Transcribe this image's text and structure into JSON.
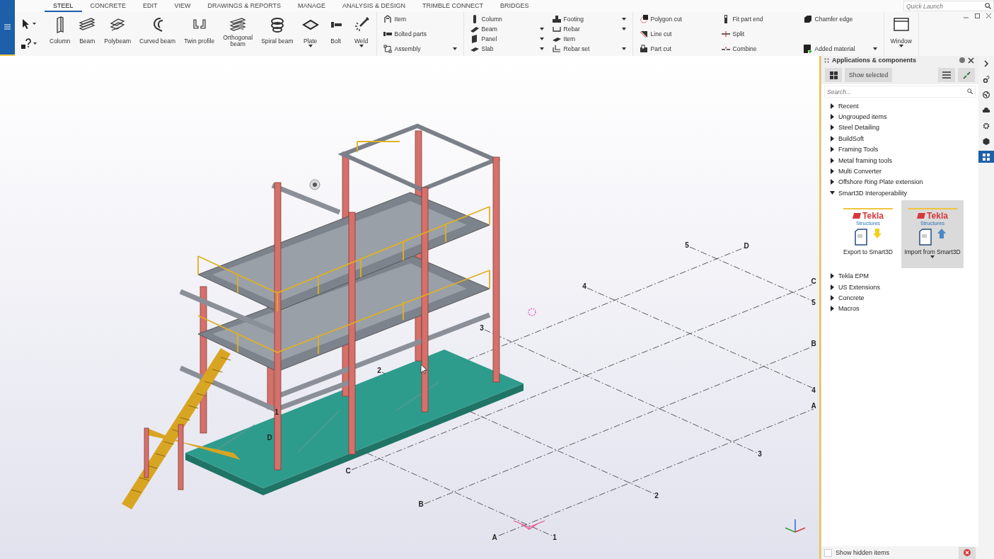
{
  "tabs": [
    {
      "label": "STEEL",
      "selected": true
    },
    {
      "label": "CONCRETE",
      "selected": false
    },
    {
      "label": "EDIT",
      "selected": false
    },
    {
      "label": "VIEW",
      "selected": false
    },
    {
      "label": "DRAWINGS & REPORTS",
      "selected": false
    },
    {
      "label": "MANAGE",
      "selected": false
    },
    {
      "label": "ANALYSIS & DESIGN",
      "selected": false
    },
    {
      "label": "TRIMBLE CONNECT",
      "selected": false
    },
    {
      "label": "BRIDGES",
      "selected": false
    }
  ],
  "quick_launch": {
    "placeholder": "Quick Launch"
  },
  "ribbon": {
    "groups": [
      {
        "kind": "large",
        "tools": [
          {
            "label": "Column",
            "dropdown": false
          },
          {
            "label": "Beam",
            "dropdown": false
          },
          {
            "label": "Polybeam",
            "dropdown": false
          },
          {
            "label": "Curved beam",
            "dropdown": false
          },
          {
            "label": "Twin profile",
            "dropdown": false
          },
          {
            "label": "Orthogonal\nbeam",
            "dropdown": false
          },
          {
            "label": "Spiral beam",
            "dropdown": false
          },
          {
            "label": "Plate",
            "dropdown": true
          },
          {
            "label": "Bolt",
            "dropdown": false
          },
          {
            "label": "Weld",
            "dropdown": true
          }
        ]
      },
      {
        "kind": "small",
        "columns": [
          [
            {
              "label": "Item",
              "dropdown": false
            },
            {
              "label": "Bolted parts",
              "dropdown": false
            },
            {
              "label": "Assembly",
              "dropdown": true
            }
          ]
        ]
      },
      {
        "kind": "small",
        "columns": [
          [
            {
              "label": "Column",
              "dropdown": false
            },
            {
              "label": "Beam",
              "dropdown": true
            },
            {
              "label": "Panel",
              "dropdown": true
            },
            {
              "label": "Slab",
              "dropdown": true
            }
          ],
          [
            {
              "label": "Footing",
              "dropdown": true
            },
            {
              "label": "Rebar",
              "dropdown": true
            },
            {
              "label": "Item",
              "dropdown": false
            },
            {
              "label": "Rebar set",
              "dropdown": true
            }
          ]
        ]
      },
      {
        "kind": "small",
        "columns": [
          [
            {
              "label": "Polygon cut",
              "dropdown": false
            },
            {
              "label": "Line cut",
              "dropdown": false
            },
            {
              "label": "Part cut",
              "dropdown": false
            }
          ],
          [
            {
              "label": "Fit part end",
              "dropdown": false
            },
            {
              "label": "Split",
              "dropdown": false
            },
            {
              "label": "Combine",
              "dropdown": false
            }
          ],
          [
            {
              "label": "Chamfer edge",
              "dropdown": false
            },
            {
              "label": "Added material",
              "dropdown": true
            }
          ]
        ]
      },
      {
        "kind": "large",
        "tools": [
          {
            "label": "Window",
            "dropdown": true
          }
        ]
      }
    ]
  },
  "viewport": {
    "grid_labels": [
      "5",
      "D",
      "4",
      "C",
      "5",
      "3",
      "B",
      "2",
      "4",
      "A",
      "1",
      "D",
      "3",
      "C",
      "2",
      "B",
      "A",
      "1"
    ]
  },
  "panel": {
    "title": "Applications & components",
    "show_selected": "Show selected",
    "search": {
      "placeholder": "Search..."
    },
    "tree": [
      {
        "label": "Recent",
        "expanded": false
      },
      {
        "label": "Ungrouped items",
        "expanded": false
      },
      {
        "label": "Steel Detailing",
        "expanded": false
      },
      {
        "label": "BuildSoft",
        "expanded": false
      },
      {
        "label": "Framing Tools",
        "expanded": false
      },
      {
        "label": "Metal framing tools",
        "expanded": false
      },
      {
        "label": "Multi Converter",
        "expanded": false
      },
      {
        "label": "Offshore Ring Plate extension",
        "expanded": false
      },
      {
        "label": "Smart3D Interoperability",
        "expanded": true,
        "children": [
          {
            "label": "Export to Smart3D",
            "kind": "export",
            "logo": "Tekla",
            "logo_sub": "Structures",
            "selected": false,
            "dropdown": false
          },
          {
            "label": "Import from Smart3D",
            "kind": "import",
            "logo": "Tekla",
            "logo_sub": "Structures",
            "selected": true,
            "dropdown": true
          }
        ]
      },
      {
        "label": "Tekla EPM",
        "expanded": false
      },
      {
        "label": "US Extensions",
        "expanded": false
      },
      {
        "label": "Concrete",
        "expanded": false
      },
      {
        "label": "Macros",
        "expanded": false
      }
    ],
    "show_hidden": {
      "label": "Show hidden items",
      "checked": false
    }
  }
}
